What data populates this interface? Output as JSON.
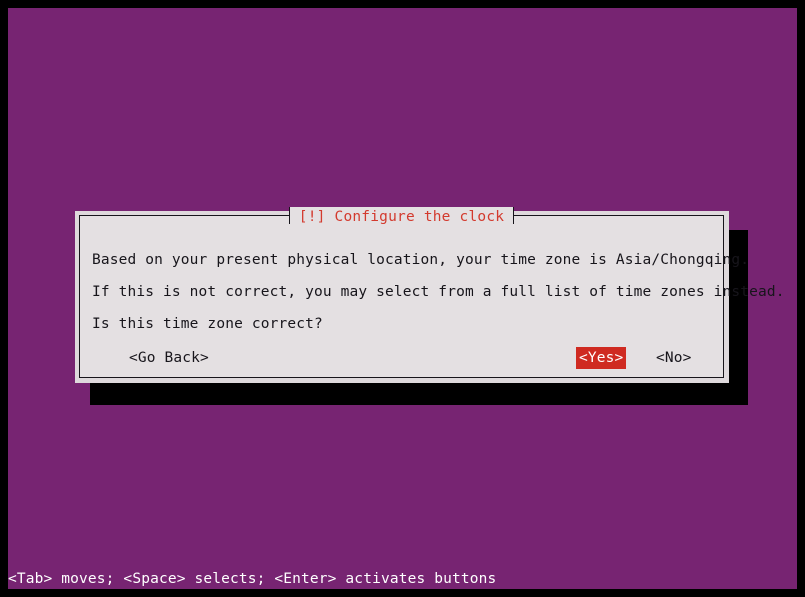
{
  "screen": {
    "background_color": "#772472",
    "bezel_color": "#000000"
  },
  "dialog": {
    "title": "[!] Configure the clock",
    "title_color": "#d33a2e",
    "background_color": "#e4e0e2",
    "border_color": "#17151b",
    "frame_color": "#ded9dc",
    "shadow_color": "#000000",
    "lines": [
      "Based on your present physical location, your time zone is Asia/Chongqing.",
      "If this is not correct, you may select from a full list of time zones instead.",
      "Is this time zone correct?"
    ],
    "buttons": [
      {
        "label": "<Go Back>",
        "selected": false
      },
      {
        "label": "<Yes>",
        "selected": true
      },
      {
        "label": "<No>",
        "selected": false
      }
    ],
    "selected_color": "#cf2a21",
    "selected_text_color": "#ffffff"
  },
  "statusbar": {
    "text": "<Tab> moves; <Space> selects; <Enter> activates buttons",
    "background_color": "#772472",
    "text_color": "#ffffff"
  }
}
